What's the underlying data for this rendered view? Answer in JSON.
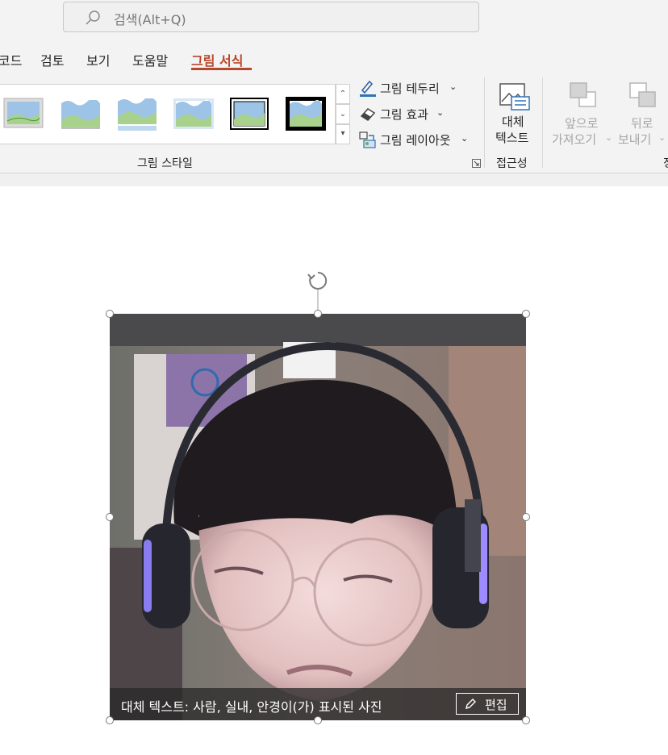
{
  "search": {
    "placeholder": "검색(Alt+Q)"
  },
  "tabs": [
    {
      "label": "코드",
      "active": false
    },
    {
      "label": "검토",
      "active": false
    },
    {
      "label": "보기",
      "active": false
    },
    {
      "label": "도움말",
      "active": false
    },
    {
      "label": "그림 서식",
      "active": true
    }
  ],
  "ribbon": {
    "picture_styles": {
      "group_label": "그림 스타일",
      "border_label": "그림 테두리",
      "effects_label": "그림 효과",
      "layout_label": "그림 레이아웃"
    },
    "accessibility": {
      "group_label": "접근성",
      "alt_text_line1": "대체",
      "alt_text_line2": "텍스트"
    },
    "arrange": {
      "bring_forward_line1": "앞으로",
      "bring_forward_line2": "가져오기",
      "send_backward_line1": "뒤로",
      "send_backward_line2": "보내기",
      "partial_group_label": "정"
    }
  },
  "picture": {
    "alt_text": "대체 텍스트: 사람, 실내, 안경이(가) 표시된 사진",
    "edit_label": "편집"
  },
  "colors": {
    "accent": "#b7472a",
    "ribbon_bg": "#f3f3f3",
    "thumb_blue": "#5b9bd5",
    "thumb_green": "#70ad47"
  }
}
